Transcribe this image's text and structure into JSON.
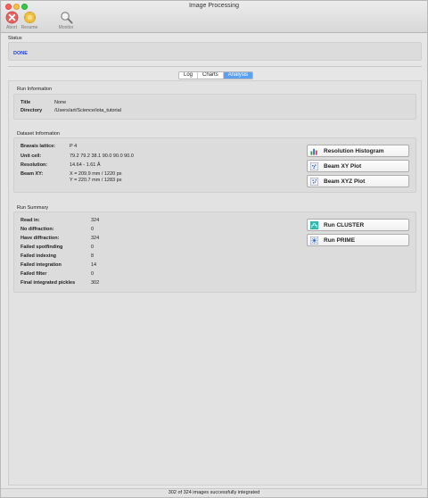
{
  "window": {
    "title": "Image Processing"
  },
  "toolbar": {
    "abort_label": "Abort",
    "resume_label": "Resume",
    "monitor_label": "Monitor"
  },
  "status": {
    "group_label": "Status",
    "value": "DONE",
    "value_color": "#1f3fd8"
  },
  "tabs": [
    {
      "label": "Log",
      "active": false
    },
    {
      "label": "Charts",
      "active": false
    },
    {
      "label": "Analysis",
      "active": true
    }
  ],
  "run_info": {
    "group_label": "Run Information",
    "title_label": "Title",
    "title_value": "None",
    "directory_label": "Directory",
    "directory_value": "/Users/art/Science/iota_tutorial"
  },
  "dataset_info": {
    "group_label": "Dataset Information",
    "bravais_label": "Bravais lattice:",
    "bravais_value": "P 4",
    "unit_cell_label": "Unit cell:",
    "unit_cell_value": "79.2 79.2 38.1 90.0 90.0 90.0",
    "resolution_label": "Resolution:",
    "resolution_value": "14.64 - 1.61 Å",
    "beam_label": "Beam XY:",
    "beam_x_value": "X = 209.9 mm / 1220 px",
    "beam_y_value": "Y = 220.7 mm / 1283 px",
    "buttons": {
      "resolution_histogram": "Resolution Histogram",
      "beam_xy_plot": "Beam XY Plot",
      "beam_xyz_plot": "Beam XYZ Plot"
    }
  },
  "run_summary": {
    "group_label": "Run Summary",
    "rows": [
      {
        "label": "Read in:",
        "value": "324"
      },
      {
        "label": "No diffraction:",
        "value": "0"
      },
      {
        "label": "Have diffraction:",
        "value": "324"
      },
      {
        "label": "Failed spotfinding",
        "value": "0"
      },
      {
        "label": "Failed indexing",
        "value": "8"
      },
      {
        "label": "Failed integration",
        "value": "14"
      },
      {
        "label": "Failed filter",
        "value": "0"
      },
      {
        "label": "Final integrated pickles",
        "value": "302"
      }
    ],
    "buttons": {
      "run_cluster": "Run CLUSTER",
      "run_prime": "Run PRIME"
    }
  },
  "statusbar": {
    "text": "302 of 324 images successfully integrated"
  },
  "colors": {
    "tab_active": "#5aa0f5",
    "abort_icon": "#e86060",
    "resume_icon": "#f0c040"
  }
}
